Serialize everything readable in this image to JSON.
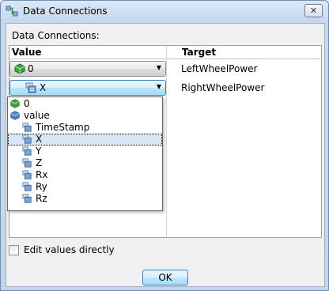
{
  "window": {
    "title": "Data Connections",
    "close_glyph": "✕"
  },
  "label": "Data Connections:",
  "grid": {
    "headers": {
      "value": "Value",
      "target": "Target"
    },
    "rows": [
      {
        "value": "0",
        "value_icon": "green-cube-icon",
        "target": "LeftWheelPower"
      },
      {
        "value": "X",
        "value_icon": "property-icon",
        "target": "RightWheelPower"
      }
    ]
  },
  "dropdown": {
    "items": [
      {
        "label": "0",
        "icon": "green-cube-icon",
        "indent": 0,
        "selected": false
      },
      {
        "label": "value",
        "icon": "blue-cube-icon",
        "indent": 0,
        "selected": false
      },
      {
        "label": "TimeStamp",
        "icon": "property-icon",
        "indent": 1,
        "selected": false
      },
      {
        "label": "X",
        "icon": "property-icon",
        "indent": 1,
        "selected": true
      },
      {
        "label": "Y",
        "icon": "property-icon",
        "indent": 1,
        "selected": false
      },
      {
        "label": "Z",
        "icon": "property-icon",
        "indent": 1,
        "selected": false
      },
      {
        "label": "Rx",
        "icon": "property-icon",
        "indent": 1,
        "selected": false
      },
      {
        "label": "Ry",
        "icon": "property-icon",
        "indent": 1,
        "selected": false
      },
      {
        "label": "Rz",
        "icon": "property-icon",
        "indent": 1,
        "selected": false
      }
    ]
  },
  "edit_directly": {
    "label": "Edit values directly",
    "checked": false
  },
  "ok_label": "OK"
}
